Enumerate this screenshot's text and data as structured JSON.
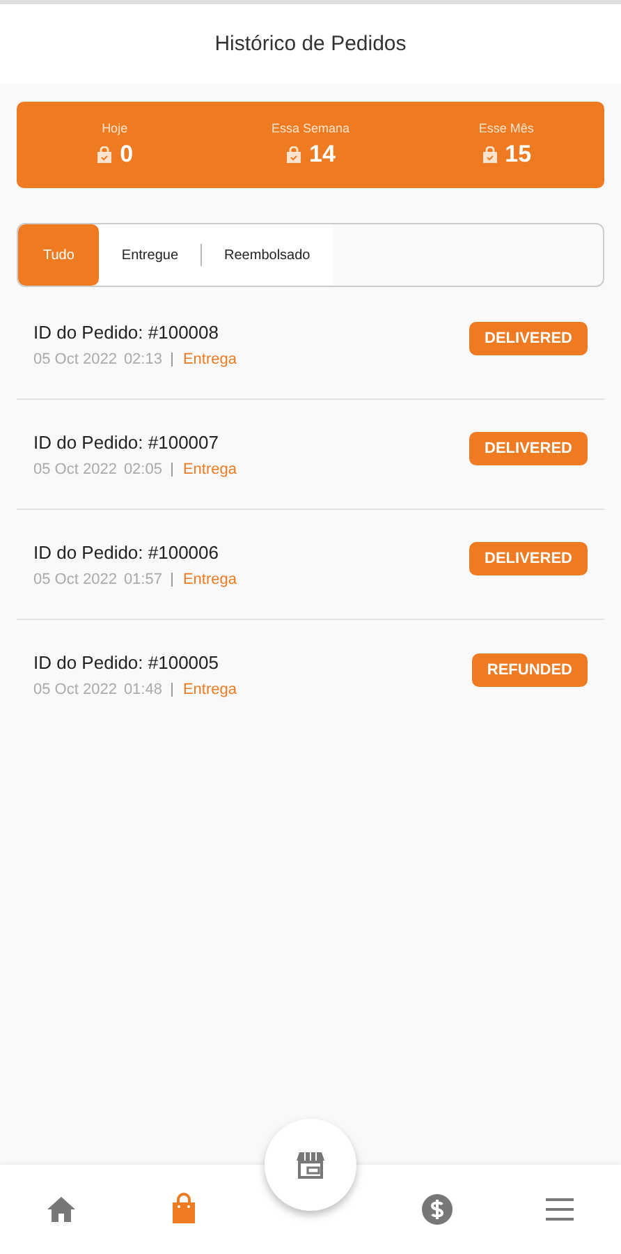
{
  "header": {
    "title": "Histórico de Pedidos"
  },
  "stats": [
    {
      "label": "Hoje",
      "value": "0"
    },
    {
      "label": "Essa Semana",
      "value": "14"
    },
    {
      "label": "Esse Mês",
      "value": "15"
    }
  ],
  "tabs": [
    {
      "label": "Tudo",
      "selected": true
    },
    {
      "label": "Entregue",
      "selected": false
    },
    {
      "label": "Reembolsado",
      "selected": false
    }
  ],
  "orders": [
    {
      "id": "ID do Pedido: #100008",
      "date": "05 Oct 2022",
      "time": "02:13",
      "type": "Entrega",
      "status": "DELIVERED"
    },
    {
      "id": "ID do Pedido: #100007",
      "date": "05 Oct 2022",
      "time": "02:05",
      "type": "Entrega",
      "status": "DELIVERED"
    },
    {
      "id": "ID do Pedido: #100006",
      "date": "05 Oct 2022",
      "time": "01:57",
      "type": "Entrega",
      "status": "DELIVERED"
    },
    {
      "id": "ID do Pedido: #100005",
      "date": "05 Oct 2022",
      "time": "01:48",
      "type": "Entrega",
      "status": "REFUNDED"
    }
  ],
  "nav": [
    {
      "kind": "home",
      "selected": false
    },
    {
      "kind": "bag",
      "selected": true
    },
    {
      "kind": "store",
      "selected": false
    },
    {
      "kind": "dollar",
      "selected": false
    },
    {
      "kind": "menu",
      "selected": false
    }
  ]
}
